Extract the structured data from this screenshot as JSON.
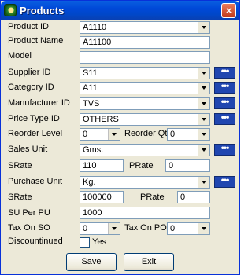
{
  "window": {
    "title": "Products",
    "close_glyph": "×"
  },
  "fields": {
    "product_id": {
      "label": "Product ID",
      "value": "A1110"
    },
    "product_name": {
      "label": "Product Name",
      "value": "A11100"
    },
    "model": {
      "label": "Model",
      "value": ""
    },
    "supplier_id": {
      "label": "Supplier ID",
      "value": "S11"
    },
    "category_id": {
      "label": "Category ID",
      "value": "A11"
    },
    "manufacturer_id": {
      "label": "Manufacturer ID",
      "value": "TVS"
    },
    "price_type_id": {
      "label": "Price Type ID",
      "value": "OTHERS"
    },
    "reorder_level": {
      "label": "Reorder Level",
      "value": "0"
    },
    "reorder_qty": {
      "label": "Reorder Qty",
      "value": "0"
    },
    "sales_unit": {
      "label": "Sales Unit",
      "value": "Gms."
    },
    "s_rate_1": {
      "label": "SRate",
      "value": "110"
    },
    "p_rate_1": {
      "label": "PRate",
      "value": "0"
    },
    "purchase_unit": {
      "label": "Purchase Unit",
      "value": "Kg."
    },
    "s_rate_2": {
      "label": "SRate",
      "value": "100000"
    },
    "p_rate_2": {
      "label": "PRate",
      "value": "0"
    },
    "su_per_pu": {
      "label": "SU Per PU",
      "value": "1000"
    },
    "tax_on_so": {
      "label": "Tax On SO",
      "value": "0"
    },
    "tax_on_po": {
      "label": "Tax On PO",
      "value": "0"
    },
    "discontinued": {
      "label": "Discountinued",
      "option_label": "Yes",
      "checked": false
    }
  },
  "lookup_button_label": "•••",
  "buttons": {
    "save": "Save",
    "exit": "Exit"
  },
  "colors": {
    "title_bar": "#0054e3",
    "lookup_button": "#2046b0",
    "close_button": "#d0502f"
  }
}
